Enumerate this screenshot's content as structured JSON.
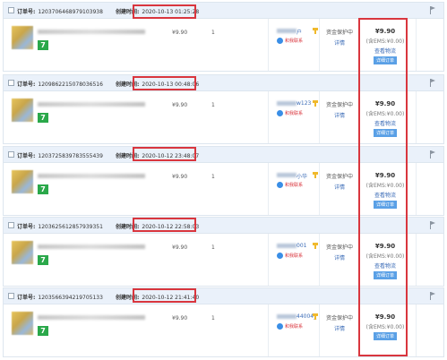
{
  "labels": {
    "order_no": "订单号:",
    "created": "创建时间:",
    "fund_status": "资金保护中",
    "detail": "详情",
    "contact": "和我联系",
    "logistics": "查看物流",
    "btn": "详细订单",
    "badge": "7"
  },
  "orders": [
    {
      "order_no": "1203706468979103938",
      "created": "2020-10-13 01:25:28",
      "price": "¥9.90",
      "qty": "1",
      "buyer": "户",
      "total": "¥9.90",
      "ems": "(含EMS:¥0.00)"
    },
    {
      "order_no": "1209862215078036516",
      "created": "2020-10-13 00:48:06",
      "price": "¥9.90",
      "qty": "1",
      "buyer": "w123",
      "total": "¥9.90",
      "ems": "(含EMS:¥0.00)"
    },
    {
      "order_no": "1203725839783555439",
      "created": "2020-10-12 23:48:07",
      "price": "¥9.90",
      "qty": "1",
      "buyer": "小华",
      "total": "¥9.90",
      "ems": "(含EMS:¥0.00)"
    },
    {
      "order_no": "1203625612857939351",
      "created": "2020-10-12 22:58:03",
      "price": "¥9.90",
      "qty": "1",
      "buyer": "001",
      "total": "¥9.90",
      "ems": "(含EMS:¥0.00)"
    },
    {
      "order_no": "1203566394219705133",
      "created": "2020-10-12 21:41:40",
      "price": "¥9.90",
      "qty": "1",
      "buyer": "44004_",
      "total": "¥9.90",
      "ems": "(含EMS:¥0.00)"
    }
  ],
  "colors": {
    "highlight": "#d9363e",
    "header_bg": "#eaf1fa",
    "link": "#3b6cb7",
    "badge": "#2aa84a"
  }
}
